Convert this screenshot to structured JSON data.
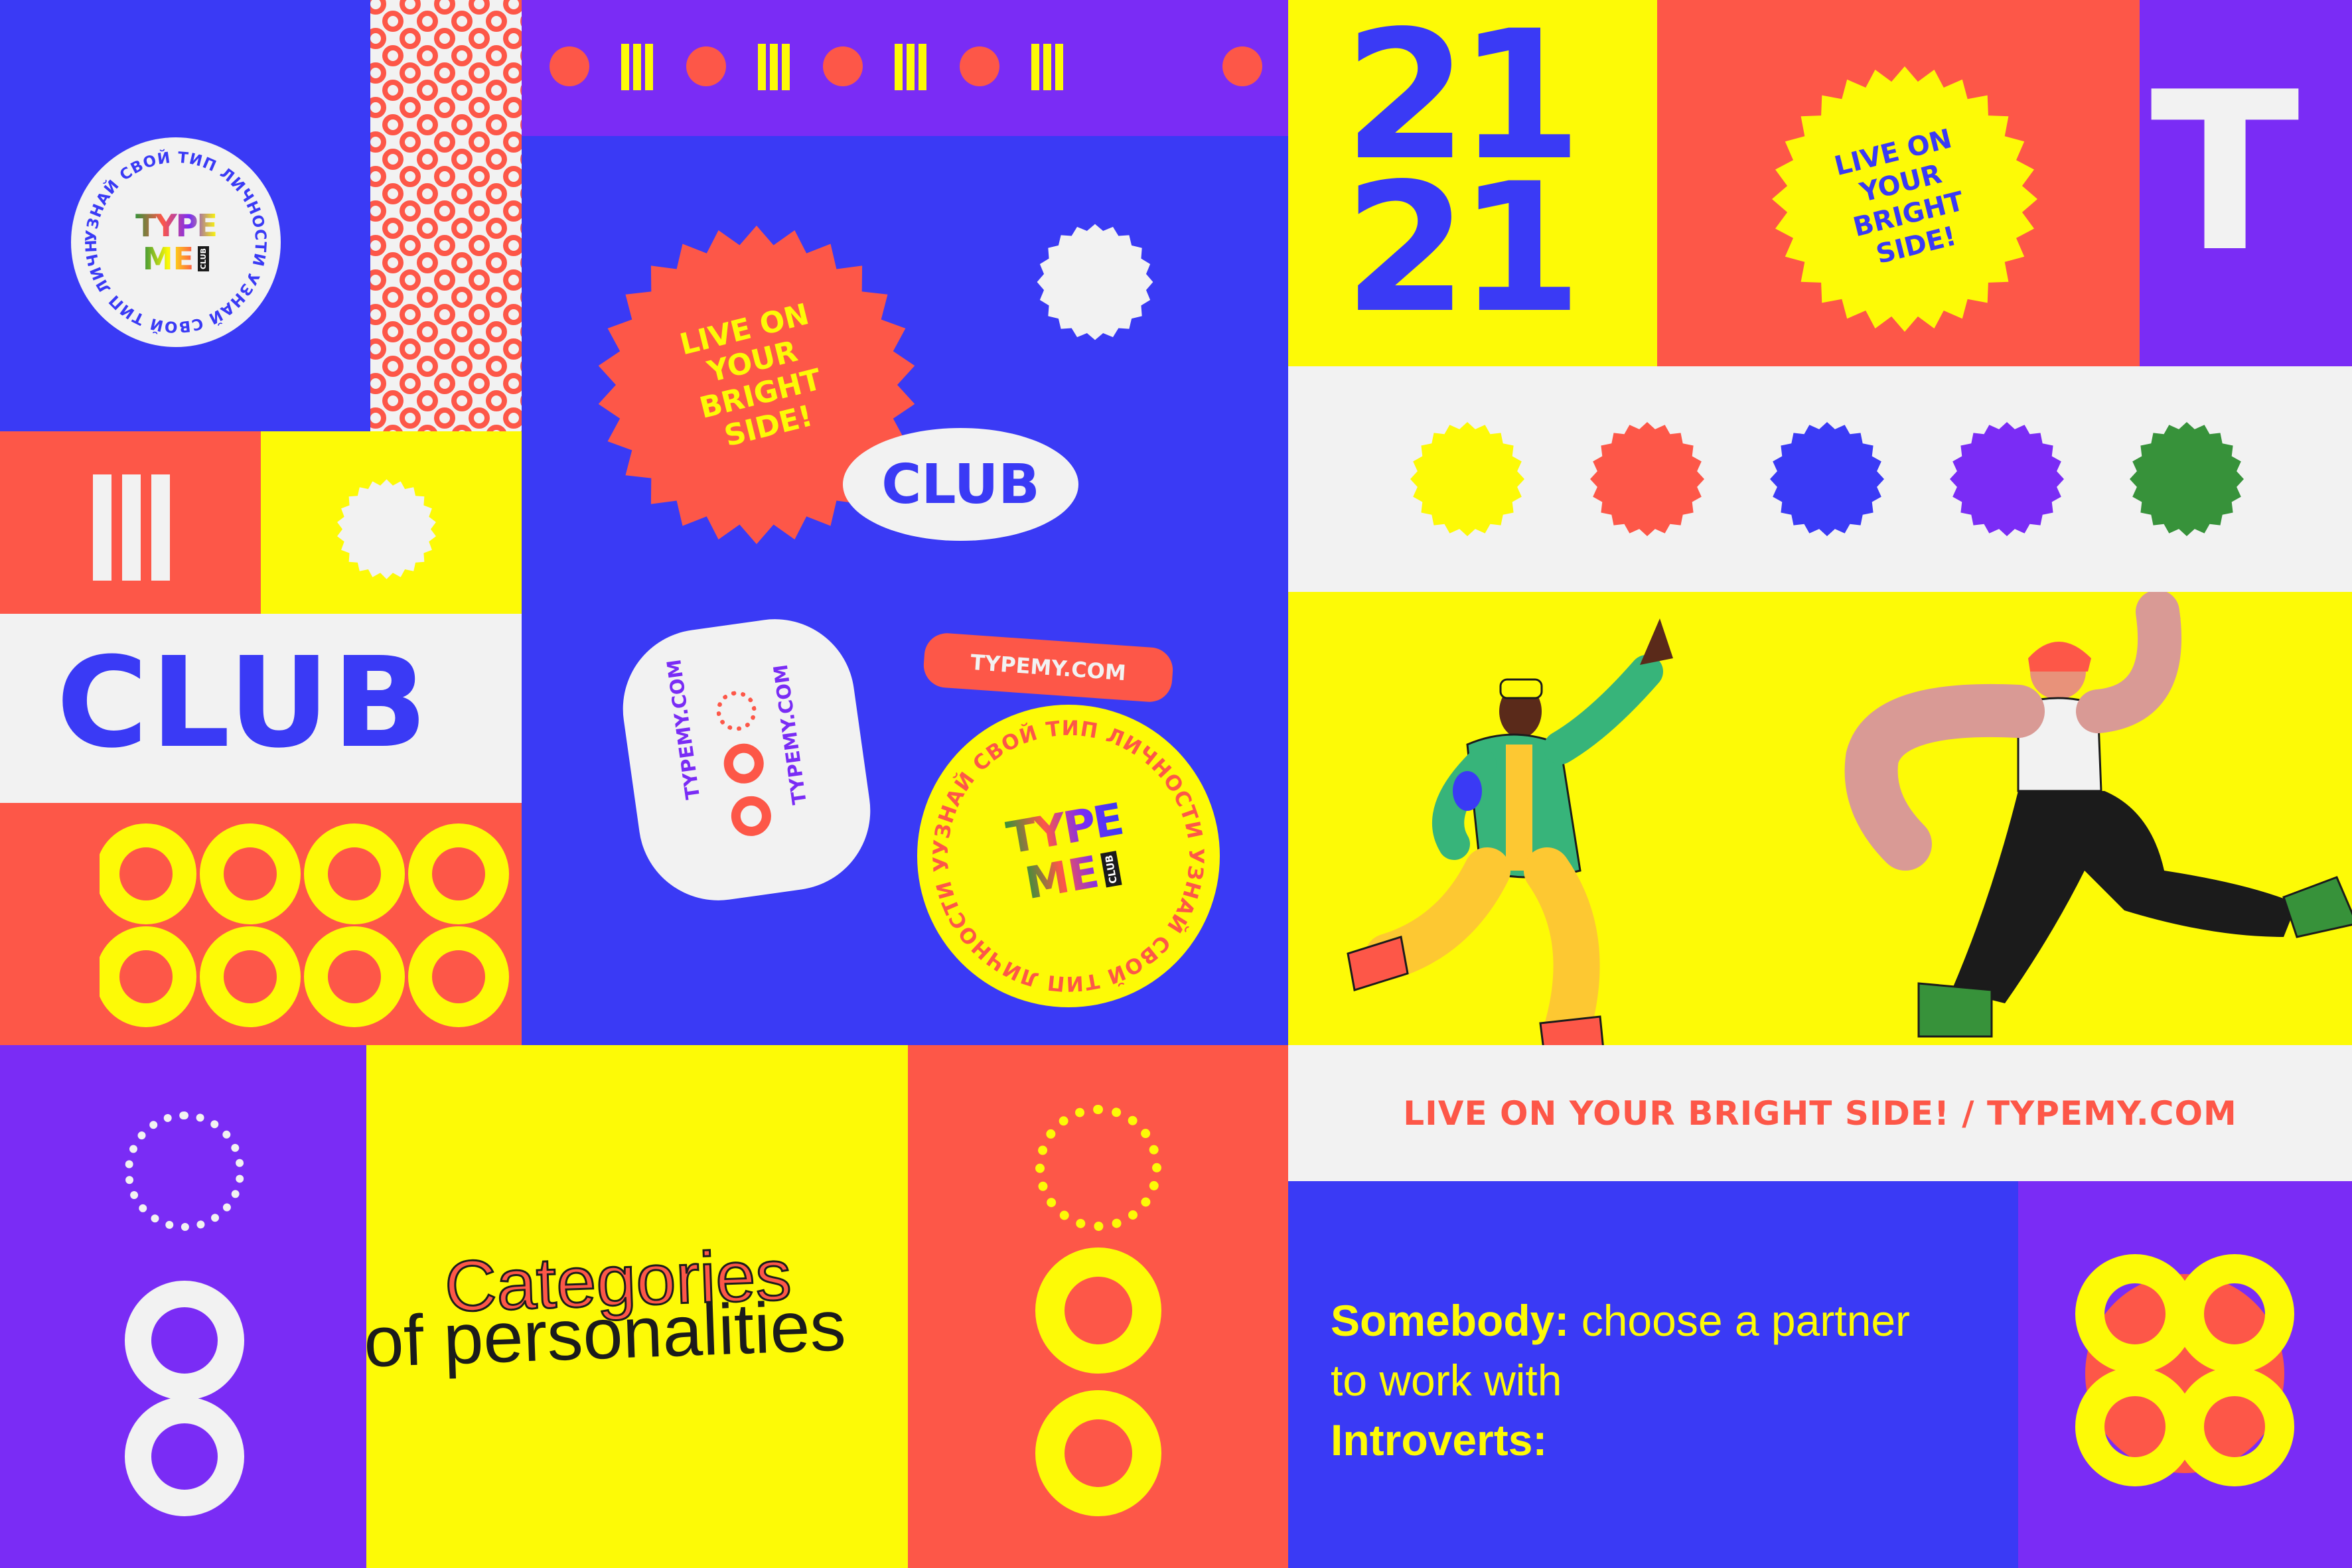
{
  "colors": {
    "blue": "#3a3af5",
    "violet": "#7a2cf5",
    "red": "#fd5748",
    "yellow": "#fdfa06",
    "white": "#f2f2f2",
    "green": "#37923a",
    "ink": "#1b1b1b"
  },
  "logo_badge": {
    "ring_text": "УЗНАЙ СВОЙ ТИП ЛИЧНОСТИ УЗНАЙ СВОЙ ТИП ЛИЧНОСТИ УЗНАЙ",
    "wordmark_top": "TYPE",
    "wordmark_bottom": "ME",
    "wordmark_tag": "CLUB"
  },
  "club_word_left": "CLUB",
  "sticker_live_on": {
    "lines": [
      "LIVE ON",
      "YOUR",
      "BRIGHT",
      "SIDE!"
    ]
  },
  "club_pill": "CLUB",
  "typemy_tag": "TYPEMY.COM",
  "vertical_tag_left": "TYPEMY.COM",
  "vertical_tag_right": "TYPEMY.COM",
  "yellow_badge": {
    "ring_text": "УЗНАЙ СВОЙ ТИП ЛИЧНОСТИ УЗНАЙ СВОЙ ТИП ЛИЧНОСТИ УЗНАЙ",
    "wordmark_top": "TYPE",
    "wordmark_bottom": "ME",
    "wordmark_tag": "CLUB"
  },
  "year": {
    "line1": "21",
    "line2": "21"
  },
  "big_letter": "T",
  "sun_badge": {
    "lines": [
      "LIVE ON",
      "YOUR",
      "BRIGHT",
      "SIDE!"
    ]
  },
  "slogan_bar": "LIVE ON YOUR BRIGHT SIDE! / TYPEMY.COM",
  "categories": {
    "line1": "Categories",
    "line2": "of personalities"
  },
  "info": {
    "label1": "Somebody:",
    "text1": " choose a partner",
    "text1b": "to work with",
    "label2": "Introverts:"
  },
  "swatches": [
    "#fdfa06",
    "#fd5748",
    "#3a3af5",
    "#7a2cf5",
    "#37923a"
  ]
}
